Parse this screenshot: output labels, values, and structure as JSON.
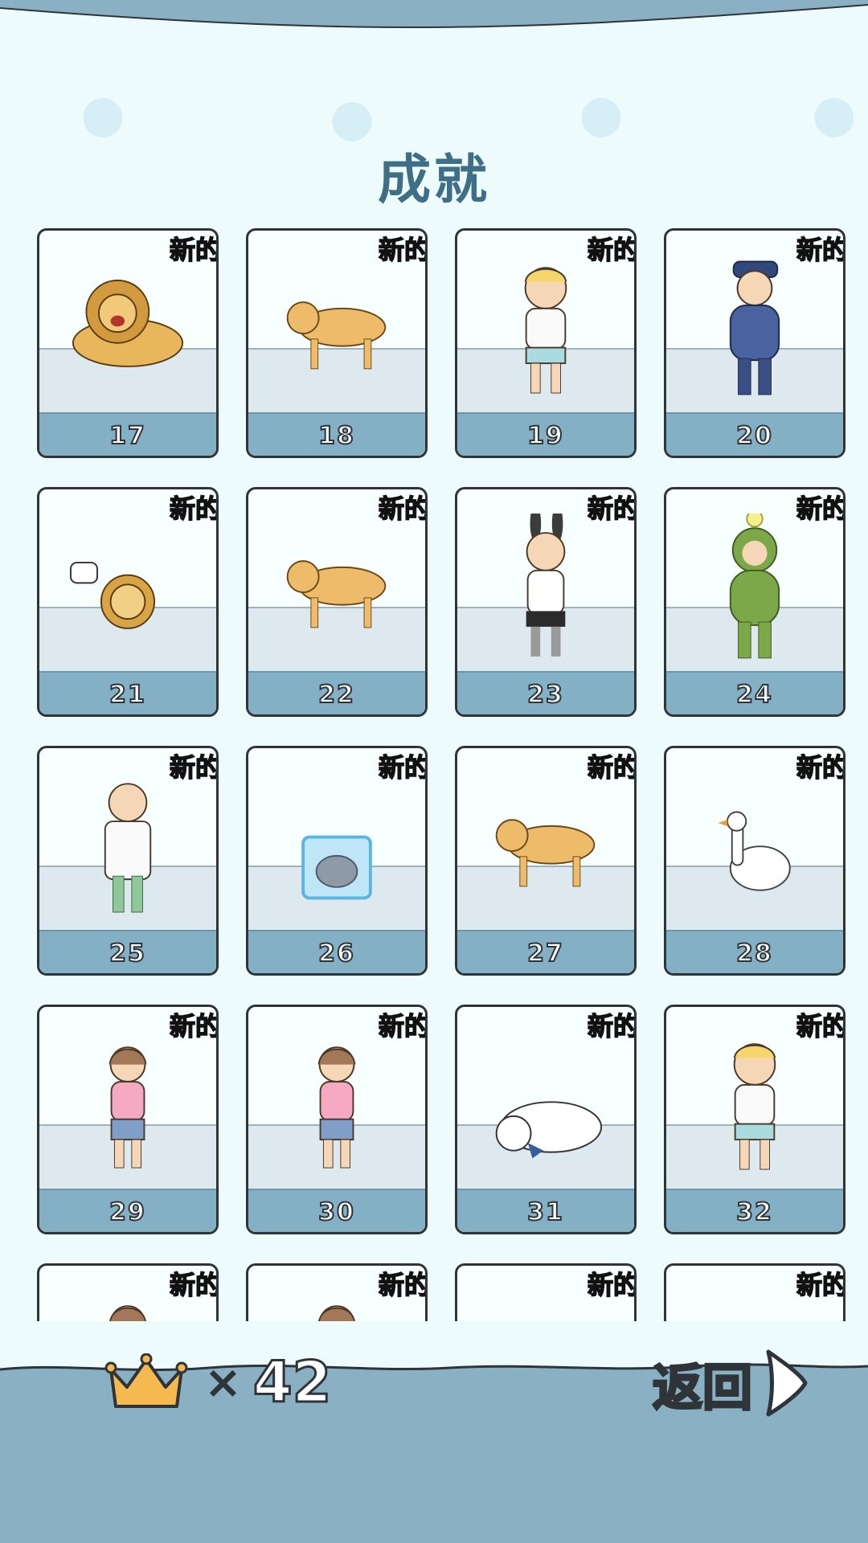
{
  "screen": {
    "title": "成就",
    "badge_label": "新的",
    "colors": {
      "background": "#eefbfd",
      "band": "#8ab0c3",
      "title": "#3f6f87",
      "badge": "#e21010",
      "card_number_bar": "#84b0c6"
    }
  },
  "cards": [
    {
      "number": "17",
      "label": "lion-roaring",
      "icon": "lion-icon",
      "new": true
    },
    {
      "number": "18",
      "label": "dog-with-bone",
      "icon": "dog-icon",
      "new": true
    },
    {
      "number": "19",
      "label": "boy-running-crying",
      "icon": "boy-icon",
      "new": true
    },
    {
      "number": "20",
      "label": "police-officer",
      "icon": "police-icon",
      "new": true
    },
    {
      "number": "21",
      "label": "lion-cub-confused",
      "icon": "lion-cub-icon",
      "new": true
    },
    {
      "number": "22",
      "label": "golden-retriever-sitting",
      "icon": "dog-icon",
      "new": true
    },
    {
      "number": "23",
      "label": "bunny-costume-man",
      "icon": "bunny-man-icon",
      "new": true
    },
    {
      "number": "24",
      "label": "green-costume",
      "icon": "green-suit-icon",
      "new": true
    },
    {
      "number": "25",
      "label": "doctor-angry",
      "icon": "doctor-icon",
      "new": true
    },
    {
      "number": "26",
      "label": "frozen-cat",
      "icon": "ice-cat-icon",
      "new": true
    },
    {
      "number": "27",
      "label": "german-shepherd",
      "icon": "dog-icon",
      "new": true
    },
    {
      "number": "28",
      "label": "angry-goose",
      "icon": "goose-icon",
      "new": true
    },
    {
      "number": "29",
      "label": "girl-running",
      "icon": "girl-icon",
      "new": true
    },
    {
      "number": "30",
      "label": "girl-blue-hair-running",
      "icon": "girl-icon",
      "new": true
    },
    {
      "number": "31",
      "label": "polar-bear-lying",
      "icon": "polar-bear-icon",
      "new": true
    },
    {
      "number": "32",
      "label": "boy-in-box",
      "icon": "boy-icon",
      "new": true
    },
    {
      "number": "",
      "label": "girl-waving",
      "icon": "girl-icon",
      "new": true
    },
    {
      "number": "",
      "label": "girl-crying",
      "icon": "girl-icon",
      "new": true
    },
    {
      "number": "",
      "label": "unknown",
      "icon": "",
      "new": true
    },
    {
      "number": "",
      "label": "unknown",
      "icon": "",
      "new": true
    }
  ],
  "footer": {
    "crown_icon": "crown-icon",
    "times_symbol": "×",
    "crown_count": "42",
    "back_label": "返回",
    "back_icon": "arrow-right-icon"
  }
}
